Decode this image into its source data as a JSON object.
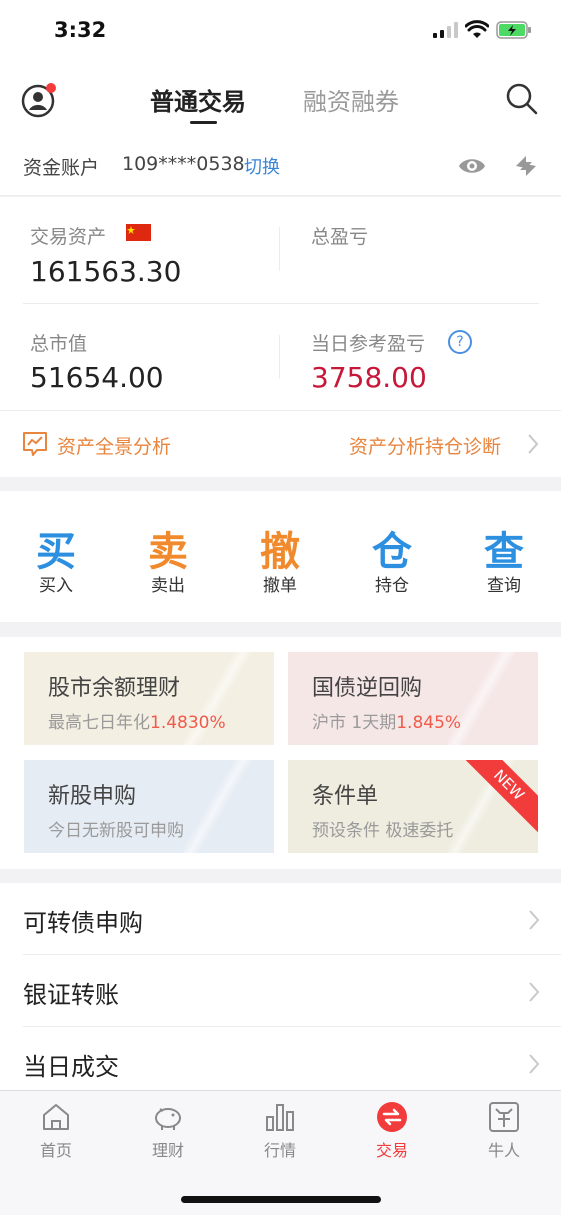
{
  "status": {
    "time": "3:32"
  },
  "header": {
    "tabs": [
      {
        "label": "普通交易",
        "active": true
      },
      {
        "label": "融资融券",
        "active": false
      }
    ]
  },
  "account": {
    "label": "资金账户",
    "number": "109****0538",
    "switch_label": "切换"
  },
  "assets": {
    "trading_assets_label": "交易资产",
    "trading_assets_value": "161563.30",
    "total_pnl_label": "总盈亏",
    "market_value_label": "总市值",
    "market_value_value": "51654.00",
    "daily_pnl_label": "当日参考盈亏",
    "daily_pnl_value": "3758.00",
    "help_glyph": "?",
    "colors": {
      "daily_pnl": "#c8183a",
      "orange": "#e8853f"
    }
  },
  "analysis": {
    "left_label": "资产全景分析",
    "right_label": "资产分析持仓诊断"
  },
  "actions": [
    {
      "glyph": "买",
      "label": "买入",
      "color": "#2d8fe0"
    },
    {
      "glyph": "卖",
      "label": "卖出",
      "color": "#f08a2c"
    },
    {
      "glyph": "撤",
      "label": "撤单",
      "color": "#f08a2c"
    },
    {
      "glyph": "仓",
      "label": "持仓",
      "color": "#2d8fe0"
    },
    {
      "glyph": "查",
      "label": "查询",
      "color": "#2d8fe0"
    }
  ],
  "cards": [
    {
      "title": "股市余额理财",
      "sub_prefix": "最高七日年化",
      "sub_rate": "1.4830%",
      "bg": "#f4efe3"
    },
    {
      "title": "国债逆回购",
      "sub_prefix": "沪市 1天期",
      "sub_rate": "1.845%",
      "bg": "#f6e7e7"
    },
    {
      "title": "新股申购",
      "sub_prefix": "今日无新股可申购",
      "sub_rate": "",
      "bg": "#e6ecf4"
    },
    {
      "title": "条件单",
      "sub_prefix": "预设条件 极速委托",
      "sub_rate": "",
      "bg": "#eeede0",
      "badge": "NEW"
    }
  ],
  "list": [
    {
      "label": "可转债申购"
    },
    {
      "label": "银证转账"
    },
    {
      "label": "当日成交"
    }
  ],
  "tabbar": [
    {
      "label": "首页",
      "icon": "home-icon"
    },
    {
      "label": "理财",
      "icon": "piggy-bank-icon"
    },
    {
      "label": "行情",
      "icon": "bar-chart-icon"
    },
    {
      "label": "交易",
      "icon": "exchange-icon",
      "active": true
    },
    {
      "label": "牛人",
      "icon": "bull-icon"
    }
  ]
}
